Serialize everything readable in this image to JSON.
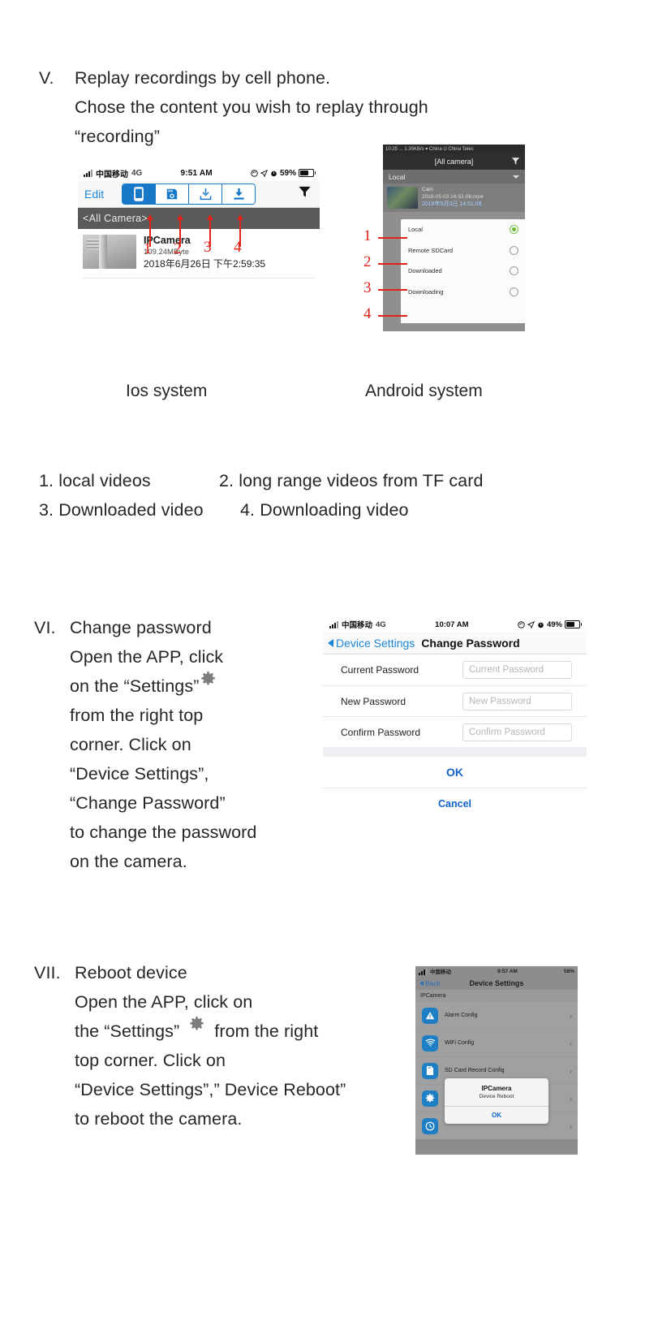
{
  "sections": {
    "five": {
      "numeral": "V.",
      "line1": "Replay recordings by cell phone.",
      "line2": "Chose the content you wish to replay through",
      "line3": "“recording”"
    },
    "six": {
      "numeral": "VI.",
      "title": "Change password",
      "body_lines": [
        "Open the APP, click",
        "on the “Settings”",
        "from the right  top",
        "corner. Click on",
        "“Device Settings”,",
        "“Change Password”",
        "to change the password",
        "on the camera."
      ],
      "gear_icon": "gear-icon"
    },
    "seven": {
      "numeral": "VII.",
      "title": "Reboot device",
      "body_lines": [
        "Open the APP, click on",
        "the “Settings”",
        "from the right",
        "top corner.  Click on",
        "“Device Settings”,” Device Reboot”",
        "to reboot the camera."
      ],
      "gear_icon": "gear-icon"
    }
  },
  "captions": {
    "ios": "Ios system",
    "android": "Android system"
  },
  "legend": {
    "item1": "1.   local videos",
    "item2": "2. long range videos from TF card",
    "item3": "3.  Downloaded video",
    "item4": "4.  Downloading video"
  },
  "ios_replay": {
    "status": {
      "carrier": "中国移动",
      "network": "4G",
      "time": "9:51 AM",
      "battery": "59%",
      "signal_icon": "signal-bars-icon",
      "location_icon": "location-arrow-icon",
      "alarm_icon": "alarm-clock-icon",
      "rotation_lock_icon": "rotation-lock-icon",
      "battery_icon": "battery-icon"
    },
    "toolbar": {
      "edit": "Edit",
      "segments": [
        {
          "name": "phone-icon",
          "label": "local"
        },
        {
          "name": "sdcard-camera-icon",
          "label": "remote-sdcard"
        },
        {
          "name": "download-tray-icon",
          "label": "downloaded"
        },
        {
          "name": "downloading-icon",
          "label": "downloading"
        }
      ],
      "filter_icon": "filter-funnel-icon"
    },
    "camera_header": "<All Camera>",
    "row": {
      "title": "IPCamera",
      "size": "109.24MByte",
      "datetime": "2018年6月26日 下午2:59:35",
      "thumbnail": "video-thumbnail"
    },
    "annotations": [
      "1",
      "2",
      "3",
      "4"
    ]
  },
  "android_shot": {
    "status": "10:25 ... 1.35KB/s ▾  China U   China Telec",
    "title": "[All camera]",
    "filter_icon": "filter-funnel-icon",
    "subheader": "Local",
    "row": {
      "name": "Cam",
      "file": "2018-05-03 14-51-08.mp4",
      "datetime": "2018年5月3日 14:51:08",
      "thumbnail": "video-thumbnail"
    },
    "popup_items": [
      {
        "label": "Local",
        "selected": true
      },
      {
        "label": "Remote SDCard",
        "selected": false
      },
      {
        "label": "Downloaded",
        "selected": false
      },
      {
        "label": "Downloading",
        "selected": false
      }
    ],
    "annotations": [
      "1",
      "2",
      "3",
      "4"
    ]
  },
  "change_password": {
    "status": {
      "carrier": "中国移动",
      "network": "4G",
      "time": "10:07 AM",
      "battery": "49%"
    },
    "back_label": "Device Settings",
    "title": "Change Password",
    "rows": [
      {
        "label": "Current Password",
        "value": "",
        "placeholder": "Current Password"
      },
      {
        "label": "New Password",
        "value": "",
        "placeholder": "New Password"
      },
      {
        "label": "Confirm Password",
        "value": "",
        "placeholder": "Confirm Password"
      }
    ],
    "ok": "OK",
    "cancel": "Cancel"
  },
  "reboot_shot": {
    "status": {
      "carrier": "中国移动",
      "time": "9:57 AM",
      "battery": "58%"
    },
    "back_label": "Back",
    "title": "Device Settings",
    "section": "IPCamera",
    "rows": [
      {
        "label": "Alarm Config",
        "icon": "alarm-warning-icon"
      },
      {
        "label": "WiFi Config",
        "icon": "wifi-icon"
      },
      {
        "label": "SD Card Record Config",
        "icon": "sdcard-icon"
      },
      {
        "label": "",
        "icon": "gear-icon"
      },
      {
        "label": "",
        "icon": "clock-icon"
      }
    ],
    "dialog": {
      "title": "IPCamera",
      "message": "Device Reboot",
      "ok": "OK"
    },
    "chevron": "›"
  }
}
